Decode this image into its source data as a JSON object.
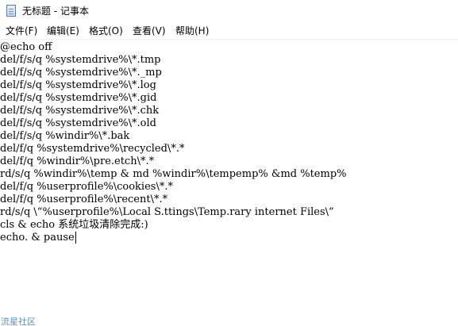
{
  "window": {
    "title": "无标题 - 记事本"
  },
  "menu": {
    "file": "文件(F)",
    "edit": "编辑(E)",
    "format": "格式(O)",
    "view": "查看(V)",
    "help": "帮助(H)"
  },
  "editor": {
    "lines": [
      "@echo off",
      "del/f/s/q %systemdrive%\\*.tmp",
      "del/f/s/q %systemdrive%\\*._mp",
      "del/f/s/q %systemdrive%\\*.log",
      "del/f/s/q %systemdrive%\\*.gid",
      "del/f/s/q %systemdrive%\\*.chk",
      "del/f/s/q %systemdrive%\\*.old",
      "del/f/s/q %windir%\\*.bak",
      "del/f/q %systemdrive%\\recycled\\*.*",
      "del/f/q %windir%\\pre.etch\\*.*",
      "rd/s/q %windir%\\temp & md %windir%\\tempemp% &md %temp%",
      "del/f/q %userprofile%\\cookies\\*.*",
      "del/f/q %userprofile%\\recent\\*.*",
      "rd/s/q \\“%userprofile%\\Local S.ttings\\Temp.rary internet Files\\”",
      "cls & echo 系统垃圾清除完成:)",
      "echo. & pause"
    ]
  },
  "watermark": {
    "text": "流星社区"
  }
}
